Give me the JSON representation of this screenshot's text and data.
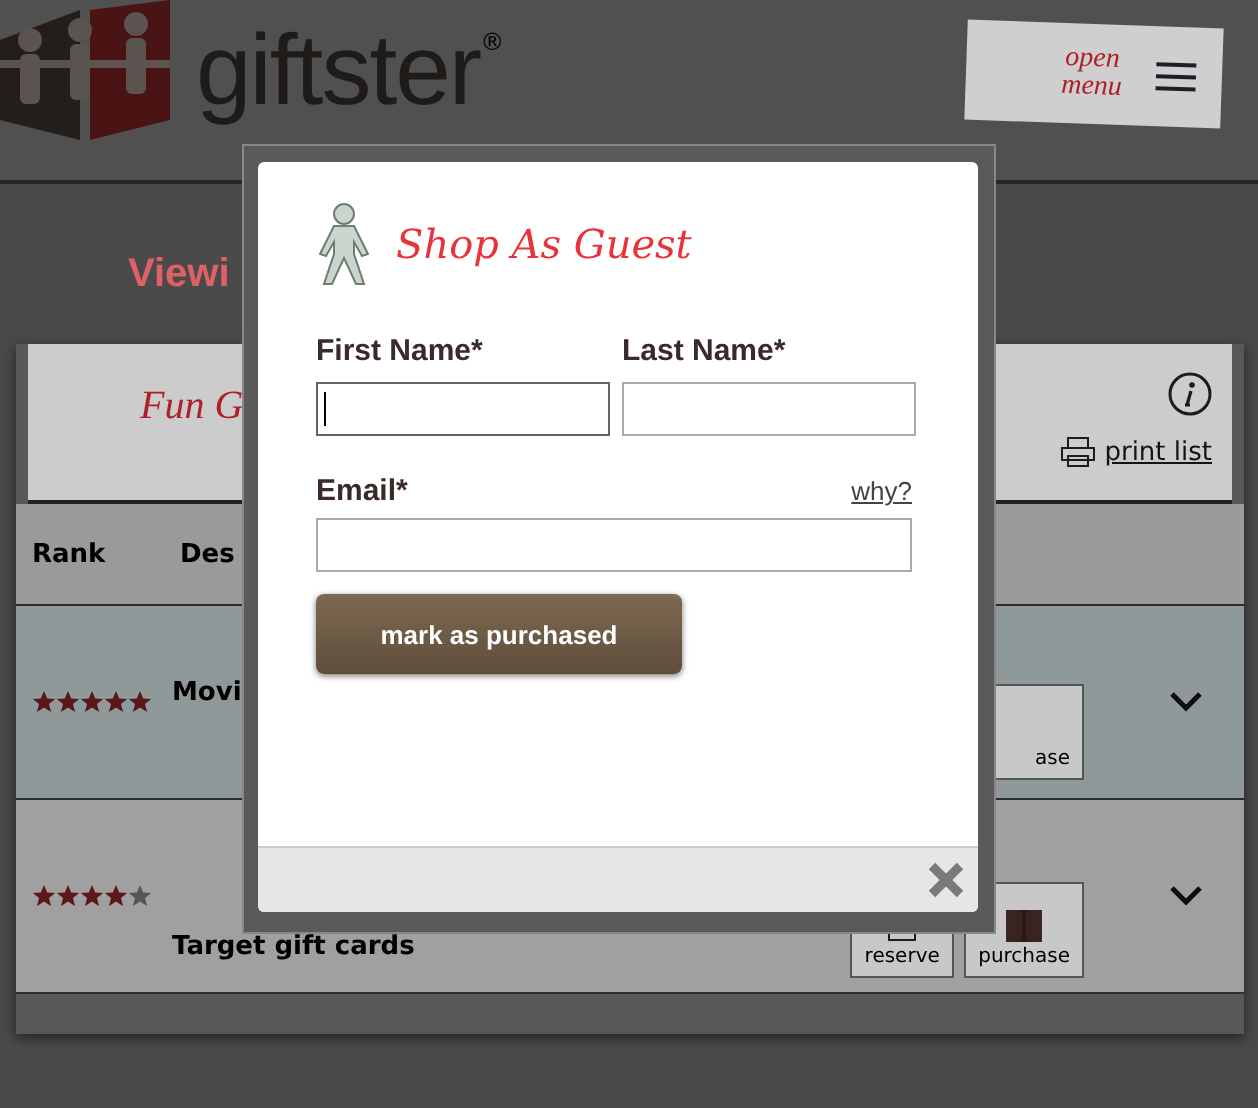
{
  "header": {
    "logo_text": "giftster",
    "registered": "®",
    "menu_note": "open menu"
  },
  "page_title": "Viewi",
  "list": {
    "title": "Fun G",
    "print_link": "print list",
    "columns": [
      "Rank",
      "Des"
    ],
    "rows": [
      {
        "stars": 5,
        "description": "Movi",
        "shaded": true,
        "actions": [
          {
            "kind": "purchase",
            "label": "ase"
          }
        ]
      },
      {
        "stars": 4,
        "description": "Target gift cards",
        "shaded": false,
        "actions": [
          {
            "kind": "reserve",
            "label": "reserve"
          },
          {
            "kind": "purchase",
            "label": "purchase"
          }
        ]
      }
    ]
  },
  "dialog": {
    "title": "Shop As Guest",
    "fields": [
      {
        "label": "First Name*",
        "focused": true
      },
      {
        "label": "Last Name*",
        "focused": false
      }
    ],
    "email": {
      "label": "Email*",
      "help_link": "why?",
      "focused": false
    },
    "submit": "mark as purchased"
  }
}
